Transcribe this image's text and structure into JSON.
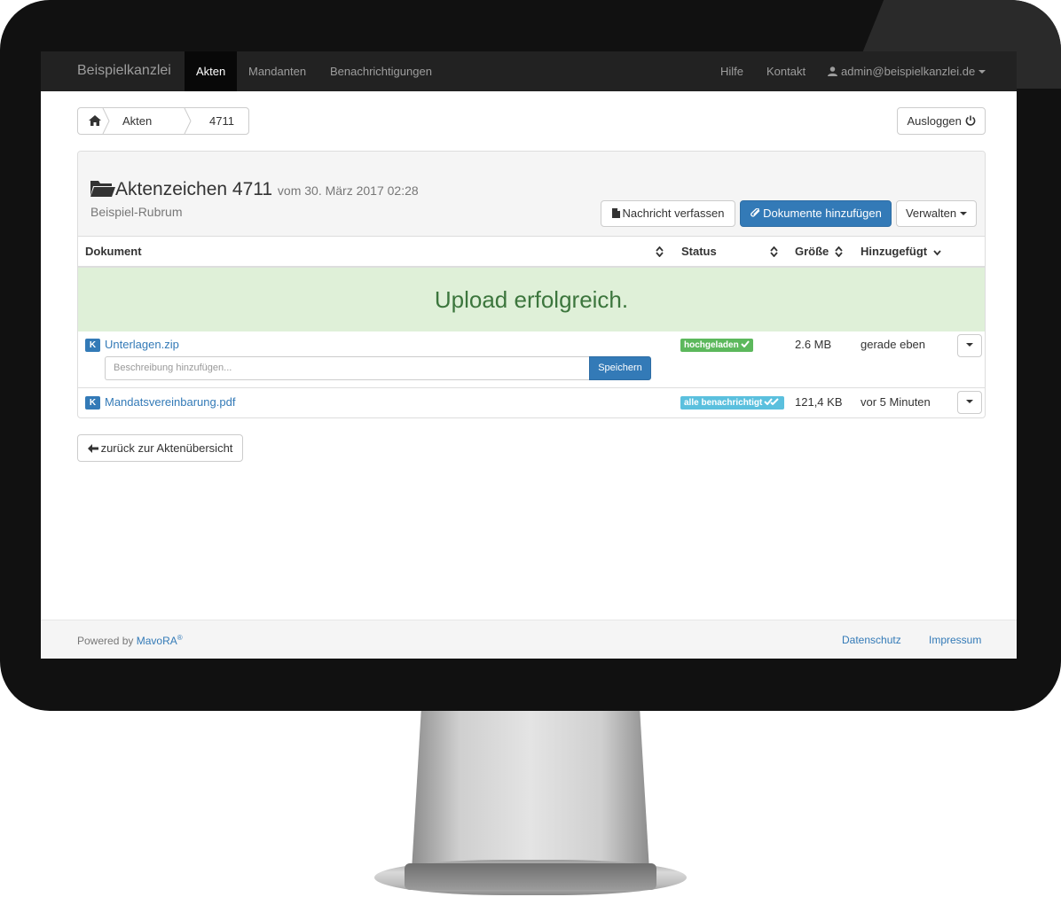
{
  "navbar": {
    "brand": "Beispielkanzlei",
    "left_items": [
      "Akten",
      "Mandanten",
      "Benachrichtigungen"
    ],
    "right_items": [
      "Hilfe",
      "Kontakt"
    ],
    "user": "admin@beispielkanzlei.de"
  },
  "breadcrumb": {
    "items": [
      "Akten",
      "4711"
    ]
  },
  "logout_label": "Ausloggen",
  "case": {
    "title": "Aktenzeichen 4711",
    "date": "vom 30. März 2017 02:28",
    "rubrum": "Beispiel-Rubrum"
  },
  "actions": {
    "compose": "Nachricht verfassen",
    "add_documents": "Dokumente hinzufügen",
    "manage": "Verwalten"
  },
  "table": {
    "headers": {
      "document": "Dokument",
      "status": "Status",
      "size": "Größe",
      "added": "Hinzugefügt"
    },
    "alert": "Upload erfolgreich.",
    "rows": [
      {
        "badge": "K",
        "name": "Unterlagen.zip",
        "status": "hochgeladen",
        "size": "2.6 MB",
        "added": "gerade eben"
      },
      {
        "badge": "K",
        "name": "Mandatsvereinbarung.pdf",
        "status": "alle benachrichtigt",
        "size": "121,4 KB",
        "added": "vor 5 Minuten"
      }
    ],
    "description_placeholder": "Beschreibung hinzufügen...",
    "save_label": "Speichern"
  },
  "back_label": "zurück zur Aktenübersicht",
  "footer": {
    "powered_by": "Powered by",
    "product": "MavoRA",
    "registered": "®",
    "links": [
      "Datenschutz",
      "Impressum"
    ]
  },
  "colors": {
    "primary": "#337ab7",
    "success": "#5cb85c",
    "info": "#5bc0de",
    "alert_bg": "#dff0d8",
    "alert_text": "#3c763d",
    "navbar_bg": "#222222"
  }
}
